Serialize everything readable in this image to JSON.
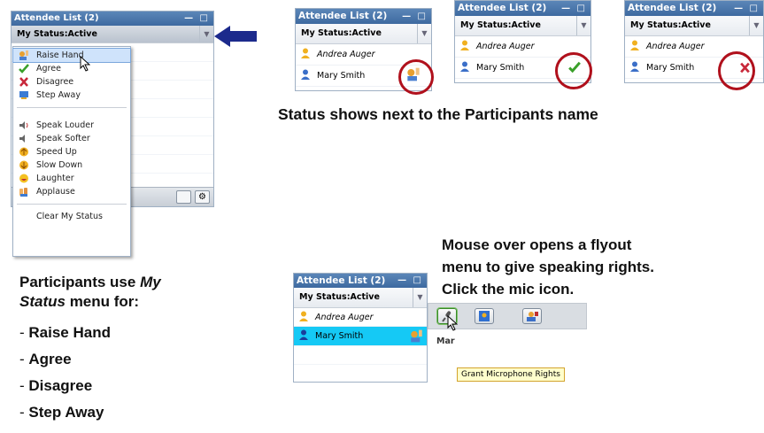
{
  "panel": {
    "title": "Attendee List (2)",
    "window_controls": "— □",
    "status_label": "My Status:Active",
    "dropdown_icon": "chevron-down-icon"
  },
  "attendees": [
    "Andrea Auger",
    "Mary Smith"
  ],
  "status_menu": {
    "group1": [
      "Raise Hand",
      "Agree",
      "Disagree",
      "Step Away"
    ],
    "group2": [
      "Speak Louder",
      "Speak Softer",
      "Speed Up",
      "Slow Down",
      "Laughter",
      "Applause"
    ],
    "clear": "Clear My Status"
  },
  "captions": {
    "status_shows": "Status shows next to the Participants name",
    "participants_use_1": "Participants use ",
    "participants_use_em1": "My",
    "participants_use_em2": "Status",
    "participants_use_2": " menu for:",
    "bullets": [
      "Raise Hand",
      "Agree",
      "Disagree",
      "Step Away"
    ],
    "mouse_over_1": "Mouse over opens a flyout",
    "mouse_over_2": "menu to give speaking rights.",
    "mouse_over_3": "Click the mic icon."
  },
  "flyout": {
    "partial_name": "Mar",
    "tooltip": "Grant Microphone Rights"
  },
  "colors": {
    "title_bar": "#4673a9",
    "selected_row": "#15c9f5",
    "highlight_circle": "#b0101c",
    "arrow": "#1c2a8c"
  }
}
